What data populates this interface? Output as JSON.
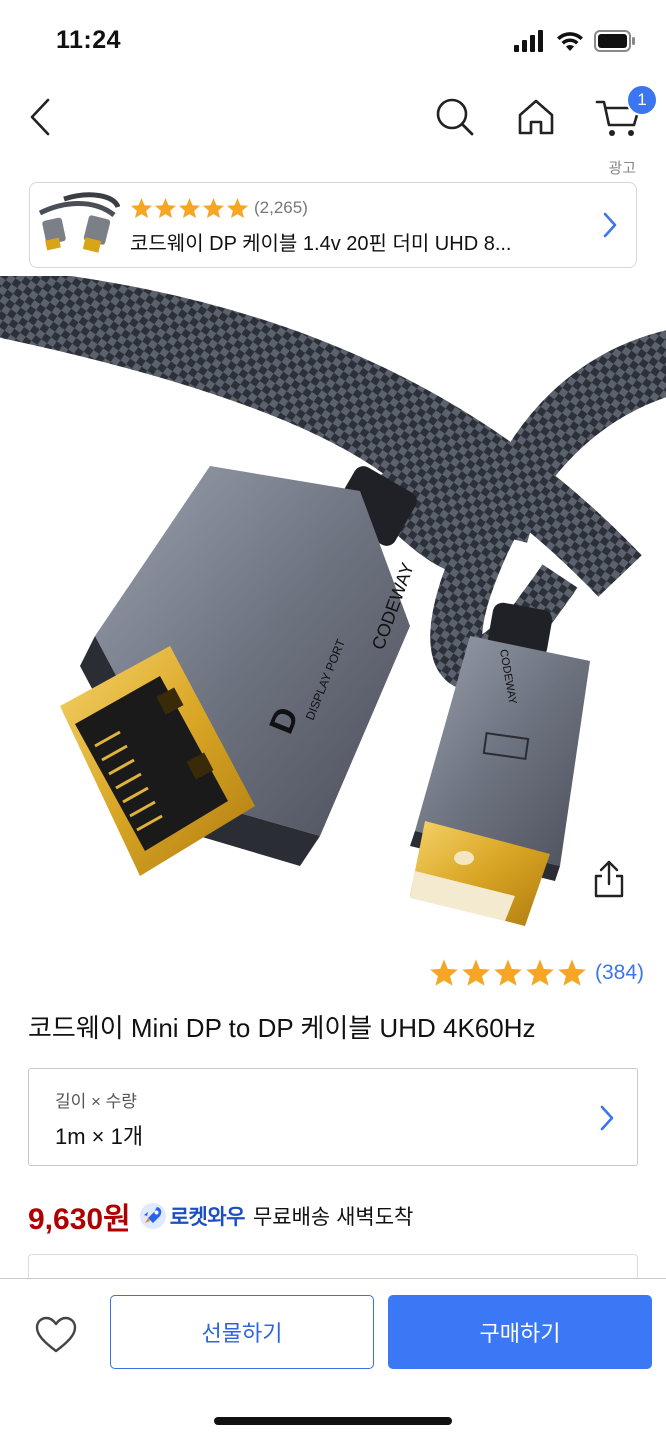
{
  "status_bar": {
    "time": "11:24",
    "icons": [
      "cellular-signal-icon",
      "wifi-icon",
      "battery-icon"
    ]
  },
  "nav": {
    "icons": [
      "back-icon",
      "search-icon",
      "home-icon",
      "cart-icon"
    ],
    "cart_badge": "1"
  },
  "ad": {
    "label": "광고",
    "rating_stars": 5,
    "review_count": "(2,265)",
    "title": "코드웨이 DP 케이블 1.4v 20핀 더미 UHD 8..."
  },
  "product": {
    "rating_stars": 5,
    "review_count": "(384)",
    "title": "코드웨이 Mini DP to DP 케이블 UHD 4K60Hz",
    "brand_print_large": "CODEWAY",
    "brand_print_small": "CODEWAY",
    "displayport_label": "DISPLAY PORT"
  },
  "option": {
    "label": "길이 × 수량",
    "value": "1m × 1개"
  },
  "price": {
    "amount": "9,630원",
    "rocket_label": "로켓와우",
    "delivery": "무료배송 새벽도착"
  },
  "actions": {
    "gift_label": "선물하기",
    "buy_label": "구매하기"
  },
  "colors": {
    "accent_blue": "#3b78f5",
    "price_red": "#ae0000",
    "star_gold": "#f5a623",
    "rocket_blue": "#1d4fc4"
  }
}
